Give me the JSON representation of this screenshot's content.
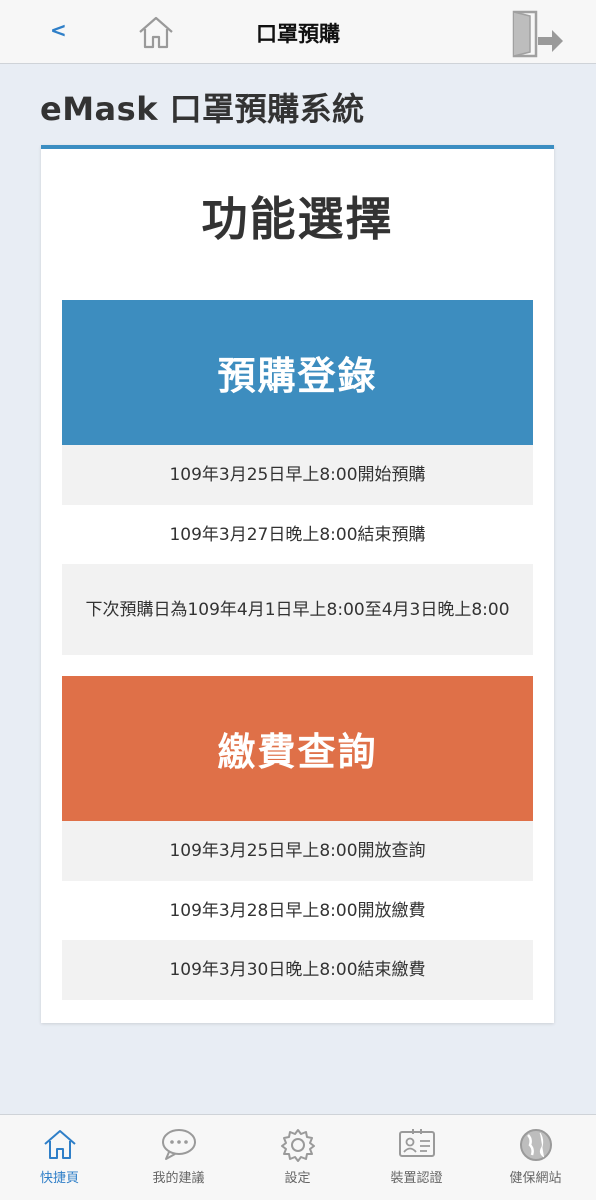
{
  "header": {
    "back_label": "<",
    "title": "口罩預購",
    "home_icon": "home-icon",
    "exit_icon": "exit-door-icon"
  },
  "app_title": "eMask 口罩預購系統",
  "card": {
    "title": "功能選擇",
    "preorder": {
      "label": "預購登錄",
      "color": "#3d8dbf",
      "info": [
        "109年3月25日早上8:00開始預購",
        "109年3月27日晚上8:00結束預購",
        "下次預購日為109年4月1日早上8:00至4月3日晚上8:00"
      ]
    },
    "payment": {
      "label": "繳費查詢",
      "color": "#df7048",
      "info": [
        "109年3月25日早上8:00開放查詢",
        "109年3月28日早上8:00開放繳費",
        "109年3月30日晚上8:00結束繳費"
      ]
    }
  },
  "tabbar": {
    "items": [
      {
        "label": "快捷頁",
        "icon": "home-icon",
        "active": true
      },
      {
        "label": "我的建議",
        "icon": "chat-bubble-icon",
        "active": false
      },
      {
        "label": "設定",
        "icon": "gear-icon",
        "active": false
      },
      {
        "label": "裝置認證",
        "icon": "id-card-icon",
        "active": false
      },
      {
        "label": "健保網站",
        "icon": "globe-icon",
        "active": false
      }
    ]
  }
}
